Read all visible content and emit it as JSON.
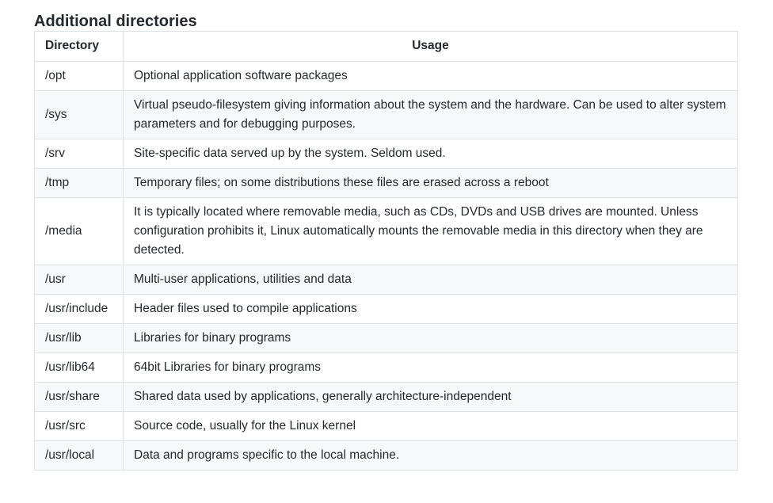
{
  "heading": "Additional directories",
  "table": {
    "headers": {
      "directory": "Directory",
      "usage": "Usage"
    },
    "rows": [
      {
        "directory": "/opt",
        "usage": "Optional application software packages"
      },
      {
        "directory": "/sys",
        "usage": "Virtual pseudo-filesystem giving information about the system and the hardware. Can be used to alter system parameters and for debugging purposes."
      },
      {
        "directory": "/srv",
        "usage": "Site-specific data served up by the system. Seldom used."
      },
      {
        "directory": "/tmp",
        "usage": "Temporary files; on some distributions these files are erased across a reboot"
      },
      {
        "directory": "/media",
        "usage": "It is typically located where removable media, such as CDs, DVDs and USB drives are mounted. Unless configuration prohibits it, Linux automatically mounts the removable media in this directory when they are detected."
      },
      {
        "directory": "/usr",
        "usage": "Multi-user applications, utilities and data"
      },
      {
        "directory": "/usr/include",
        "usage": "Header files used to compile applications"
      },
      {
        "directory": "/usr/lib",
        "usage": "Libraries for binary programs"
      },
      {
        "directory": "/usr/lib64",
        "usage": "64bit Libraries for binary programs"
      },
      {
        "directory": "/usr/share",
        "usage": "Shared data used by applications, generally architecture-independent"
      },
      {
        "directory": "/usr/src",
        "usage": "Source code, usually for the Linux kernel"
      },
      {
        "directory": "/usr/local",
        "usage": "Data and programs specific to the local machine."
      }
    ]
  }
}
